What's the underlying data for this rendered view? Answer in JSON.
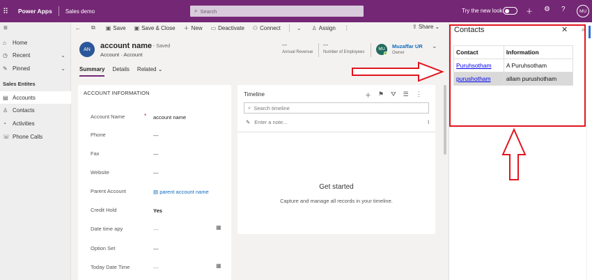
{
  "topbar": {
    "app_name": "Power Apps",
    "env_name": "Sales demo",
    "search_placeholder": "Search",
    "try_new_look": "Try the new look",
    "user_initials": "MU"
  },
  "sidebar": {
    "items": [
      {
        "label": "Home",
        "icon": "home-icon"
      },
      {
        "label": "Recent",
        "icon": "clock-icon"
      },
      {
        "label": "Pinned",
        "icon": "pin-icon"
      }
    ],
    "group_label": "Sales Entites",
    "entities": [
      {
        "label": "Accounts",
        "icon": "building-icon"
      },
      {
        "label": "Contacts",
        "icon": "person-icon"
      },
      {
        "label": "Activities",
        "icon": "activity-icon"
      },
      {
        "label": "Phone Calls",
        "icon": "phone-icon"
      }
    ]
  },
  "commands": {
    "save": "Save",
    "save_close": "Save & Close",
    "new": "New",
    "deactivate": "Deactivate",
    "connect": "Connect",
    "assign": "Assign",
    "share": "Share"
  },
  "record": {
    "initials": "AN",
    "title": "account name",
    "saved": "- Saved",
    "subtitle": "Account · Account",
    "annual_revenue_value": "---",
    "annual_revenue_label": "Annual Revenue",
    "employees_value": "---",
    "employees_label": "Number of Employees",
    "owner_initials": "MU",
    "owner_name": "Muzaffar UR",
    "owner_label": "Owner"
  },
  "tabs": [
    "Summary",
    "Details",
    "Related"
  ],
  "account_info": {
    "section_title": "ACCOUNT INFORMATION",
    "fields": [
      {
        "label": "Account Name",
        "value": "account name",
        "required": "*"
      },
      {
        "label": "Phone",
        "value": "---"
      },
      {
        "label": "Fax",
        "value": "---"
      },
      {
        "label": "Website",
        "value": "---"
      },
      {
        "label": "Parent Account",
        "value": "parent account name"
      },
      {
        "label": "Credit Hold",
        "value": "Yes"
      },
      {
        "label": "Date time apy",
        "value": "---"
      },
      {
        "label": "Option Set",
        "value": "---"
      },
      {
        "label": "Today Date Time",
        "value": "---"
      }
    ]
  },
  "timeline": {
    "title": "Timeline",
    "search_placeholder": "Search timeline",
    "note_placeholder": "Enter a note...",
    "empty_title": "Get started",
    "empty_sub": "Capture and manage all records in your timeline."
  },
  "contacts_panel": {
    "title": "Contacts",
    "headers": [
      "Contact",
      "Information"
    ],
    "rows": [
      {
        "contact": "Puruhsotham",
        "info": "A Puruhsotham"
      },
      {
        "contact": "purushotham",
        "info": "allam purushotham"
      }
    ]
  },
  "colors": {
    "brand": "#742774",
    "annotation": "#e0141e",
    "avatar": "#2b579a",
    "link": "#0f6cbd"
  }
}
